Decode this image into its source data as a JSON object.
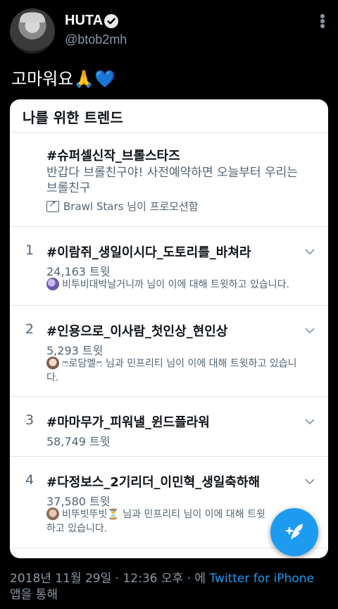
{
  "user": {
    "display_name": "HUTA",
    "handle": "@btob2mh"
  },
  "tweet": {
    "text": "고마워요",
    "emoji_hands": "🙏",
    "emoji_heart": "💙"
  },
  "card": {
    "title": "나를 위한 트렌드",
    "promoted": {
      "name": "#슈퍼셀신작_브롤스타즈",
      "description": "반갑다 브롤친구야! 사전예약하면 오늘부터 우리는 브롤친구",
      "promoted_by": "Brawl Stars 님이 프로모션함"
    },
    "trends": [
      {
        "rank": "1",
        "name": "#이람쥐_생일이시다_도토리를_바쳐라",
        "count": "24,163 트윗",
        "context": "비투비대박날거니까 님이 이에 대해 트윗하고 있습니다."
      },
      {
        "rank": "2",
        "name": "#인용으로_이사람_첫인상_현인상",
        "count": "5,293 트윗",
        "context": "ෆ로담멜ෆ 님과 민프리티 님이 이에 대해 트윗하고 있습니다."
      },
      {
        "rank": "3",
        "name": "#마마무가_피워낼_윈드플라워",
        "count": "58,749 트윗",
        "context": ""
      },
      {
        "rank": "4",
        "name": "#다정보스_2기리더_이민혁_생일축하해",
        "count": "37,580 트윗",
        "context": "비뚜빗뚜빗⏳ 님과 민프리티 님이 이에 대해 트윗하고 있습니다."
      }
    ]
  },
  "footer": {
    "timestamp": "2018년 11월 29일 · 12:36 오후 · 에",
    "via": "Twitter for iPhone",
    "suffix": "앱을 통해"
  },
  "colors": {
    "accent": "#1d9bf0",
    "background": "#000000",
    "card_bg": "#ffffff",
    "secondary_text": "#536471"
  },
  "icons": [
    "verified-icon",
    "more-icon",
    "promoted-icon",
    "chevron-down-icon",
    "compose-tweet-icon"
  ]
}
